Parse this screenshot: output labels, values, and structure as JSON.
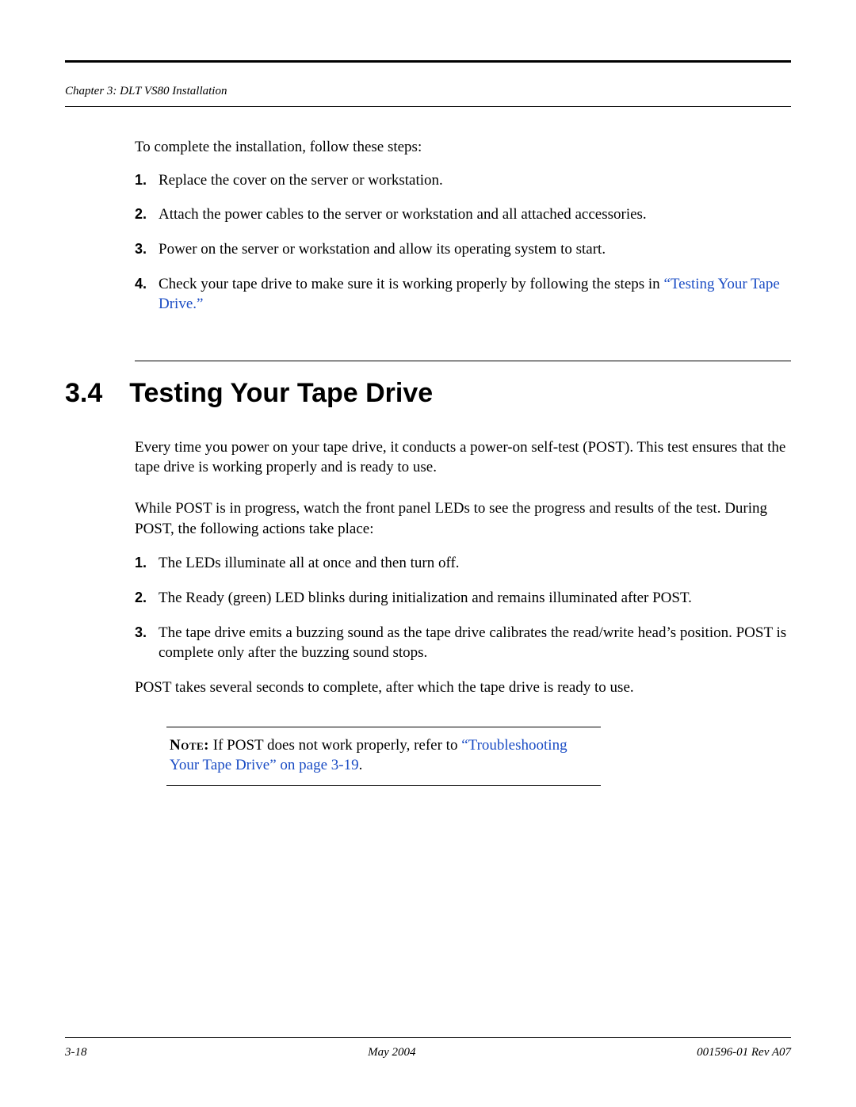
{
  "header": {
    "chapter_line": "Chapter 3:  DLT VS80 Installation"
  },
  "intro_text": "To complete the installation, follow these steps:",
  "install_steps": [
    "Replace the cover on the server or workstation.",
    "Attach the power cables to the server or workstation and all attached accessories.",
    "Power on the server or workstation and allow its operating system to start."
  ],
  "install_step4_prefix": "Check your tape drive to make sure it is working properly by following the steps in ",
  "install_step4_link": "“Testing Your Tape Drive.”",
  "section": {
    "number": "3.4",
    "title": "Testing Your Tape Drive"
  },
  "para_post_intro": "Every time you power on your tape drive, it conducts a power-on self-test (POST). This test ensures that the tape drive is working properly and is ready to use.",
  "para_watch": "While POST is in progress, watch the front panel LEDs to see the progress and results of the test. During POST, the following actions take place:",
  "post_steps": [
    "The LEDs illuminate all at once and then turn off.",
    "The Ready (green) LED blinks during initialization and remains illuminated after POST.",
    "The tape drive emits a buzzing sound as the tape drive calibrates the read/write head’s position. POST is complete only after the buzzing sound stops."
  ],
  "para_post_complete": "POST takes several seconds to complete, after which the tape drive is ready to use.",
  "note": {
    "label": "Note:",
    "text_before_link": "  If POST does not work properly, refer to ",
    "link": "“Troubleshooting Your Tape Drive” on page 3-19",
    "text_after_link": "."
  },
  "footer": {
    "page": "3-18",
    "date": "May 2004",
    "doc": "001596-01 Rev A07"
  }
}
